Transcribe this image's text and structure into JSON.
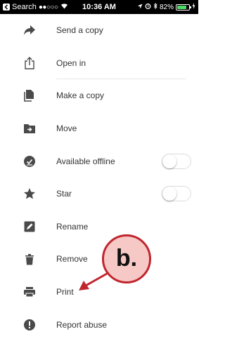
{
  "status_bar": {
    "back_label": "Search",
    "signal": "●●○○○",
    "time": "10:36 AM",
    "battery_text": "82%",
    "battery_level": 0.82
  },
  "menu": {
    "items": [
      {
        "label": "Send a copy",
        "icon": "share-arrow-icon"
      },
      {
        "label": "Open in",
        "icon": "open-in-icon"
      },
      {
        "label": "Make a copy",
        "icon": "copy-icon"
      },
      {
        "label": "Move",
        "icon": "move-folder-icon"
      },
      {
        "label": "Available offline",
        "icon": "offline-check-icon",
        "toggle": false
      },
      {
        "label": "Star",
        "icon": "star-icon",
        "toggle": false
      },
      {
        "label": "Rename",
        "icon": "rename-pencil-icon"
      },
      {
        "label": "Remove",
        "icon": "trash-icon"
      },
      {
        "label": "Print",
        "icon": "printer-icon"
      },
      {
        "label": "Report abuse",
        "icon": "report-icon"
      }
    ]
  },
  "annotation": {
    "label": "b.",
    "color": "#c0262f",
    "fill": "#f7c9c6"
  },
  "colors": {
    "icon": "#4a4a4a",
    "text": "#333333"
  }
}
